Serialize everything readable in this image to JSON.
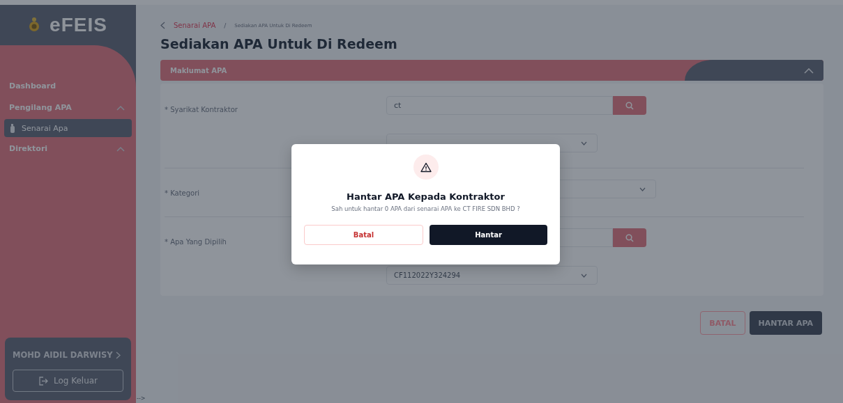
{
  "sidebar": {
    "logo": "eFEIS",
    "items": [
      {
        "label": "Dashboard",
        "expanded": false,
        "selected": false
      },
      {
        "label": "Pengilang APA",
        "expanded": true,
        "selected": false,
        "children": [
          {
            "label": "Senarai Apa",
            "selected": true
          }
        ]
      },
      {
        "label": "Direktori",
        "expanded": true,
        "selected": false
      }
    ],
    "user": {
      "name": "MOHD AIDIL DARWISY",
      "logout": "Log Keluar"
    }
  },
  "stray_text": "-->",
  "breadcrumb": [
    {
      "label": "Senarai APA",
      "kind": "link"
    },
    {
      "label": "Sediakan APA Untuk Di Redeem",
      "kind": "current"
    }
  ],
  "breadcrumb_separator": "/",
  "page_title": "Sediakan APA Untuk Di Redeem",
  "panel": {
    "title": "Maklumat APA",
    "expanded": true,
    "rows": [
      {
        "label": "* Syarikat Kontraktor",
        "fields": [
          {
            "kind": "search",
            "value": "ct"
          },
          {
            "kind": "select",
            "short": true
          }
        ]
      },
      {
        "label": "* Kategori",
        "fields": [
          {
            "kind": "select",
            "short": false
          }
        ]
      },
      {
        "label": "* Apa Yang Dipilih",
        "fields": [
          {
            "kind": "search"
          },
          {
            "kind": "select",
            "value": "CF112022Y324294",
            "short": true
          }
        ]
      }
    ]
  },
  "actions": [
    {
      "label": "BATAL",
      "kind": "outline"
    },
    {
      "label": "HANTAR APA",
      "kind": "primary"
    }
  ],
  "dialog": {
    "title": "Hantar APA Kepada Kontraktor",
    "message": "Sah untuk hantar 0 APA dari senarai APA ke CT FIRE SDN BHD ?",
    "buttons": [
      {
        "label": "Batal",
        "kind": "outline"
      },
      {
        "label": "Hantar",
        "kind": "primary"
      }
    ]
  }
}
